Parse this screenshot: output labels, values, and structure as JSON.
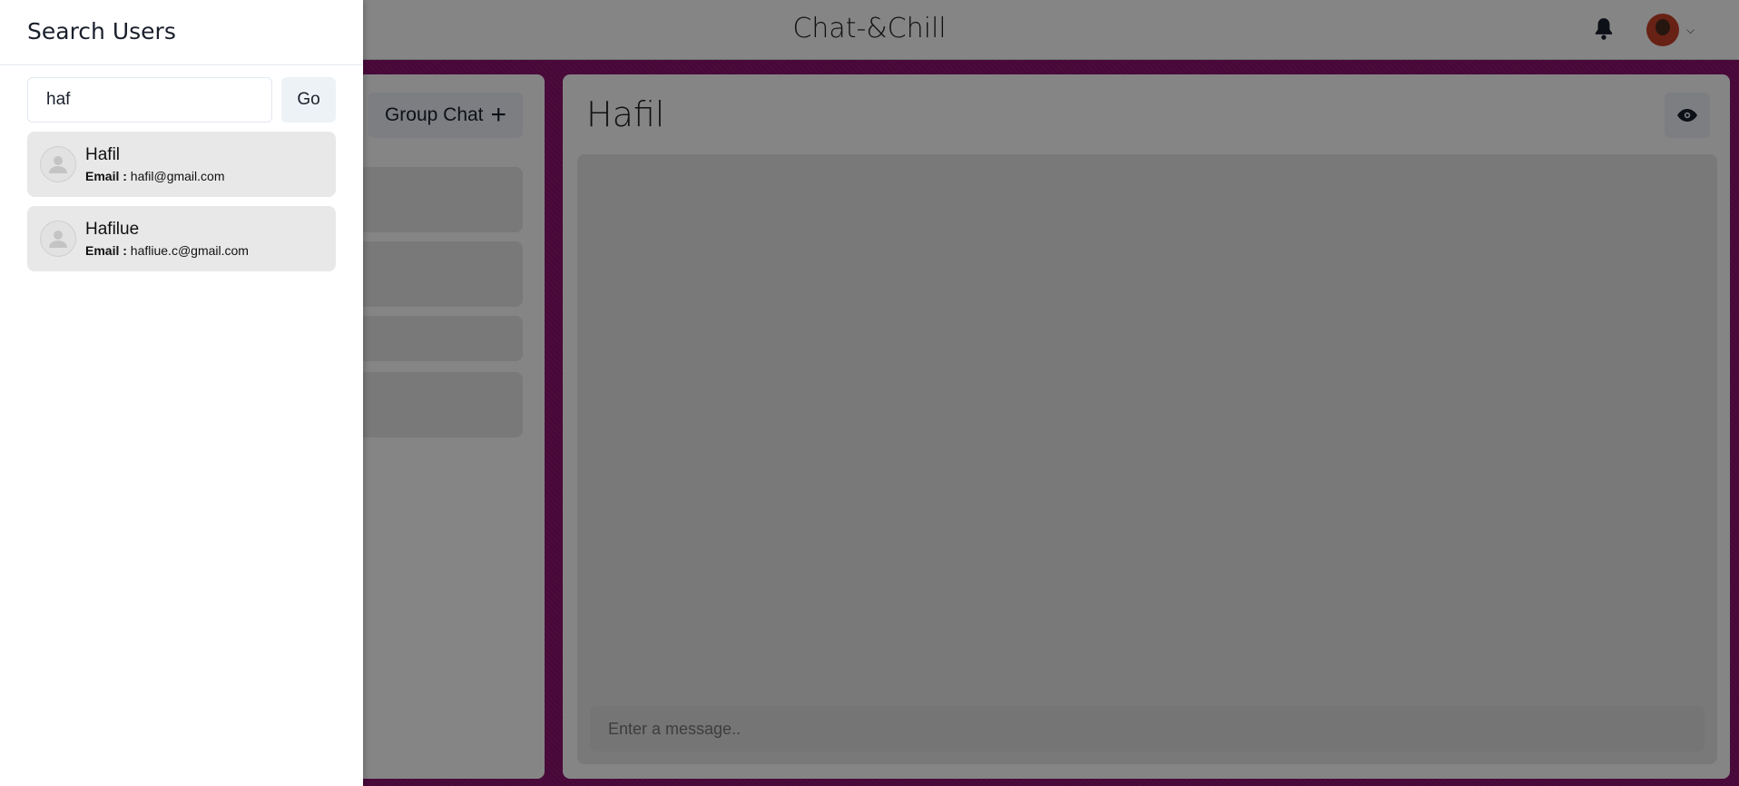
{
  "header": {
    "app_title": "Chat-&Chill"
  },
  "left_panel": {
    "group_chat_label": "Group Chat",
    "group_chat_icon": "+"
  },
  "chat": {
    "title": "Hafil",
    "message_placeholder": "Enter a message.."
  },
  "drawer": {
    "title": "Search Users",
    "search_value": "haf",
    "go_label": "Go",
    "results": [
      {
        "name": "Hafil",
        "email_label": "Email :",
        "email": "hafil@gmail.com"
      },
      {
        "name": "Hafilue",
        "email_label": "Email :",
        "email": "hafliue.c@gmail.com"
      }
    ]
  }
}
